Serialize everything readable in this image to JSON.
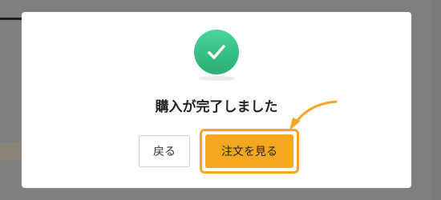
{
  "modal": {
    "icon": "check-circle-icon",
    "title": "購入が完了しました",
    "back_label": "戻る",
    "order_label": "注文を見る"
  },
  "colors": {
    "success": "#2fb87c",
    "accent": "#f5a81f",
    "overlay": "#808080"
  }
}
